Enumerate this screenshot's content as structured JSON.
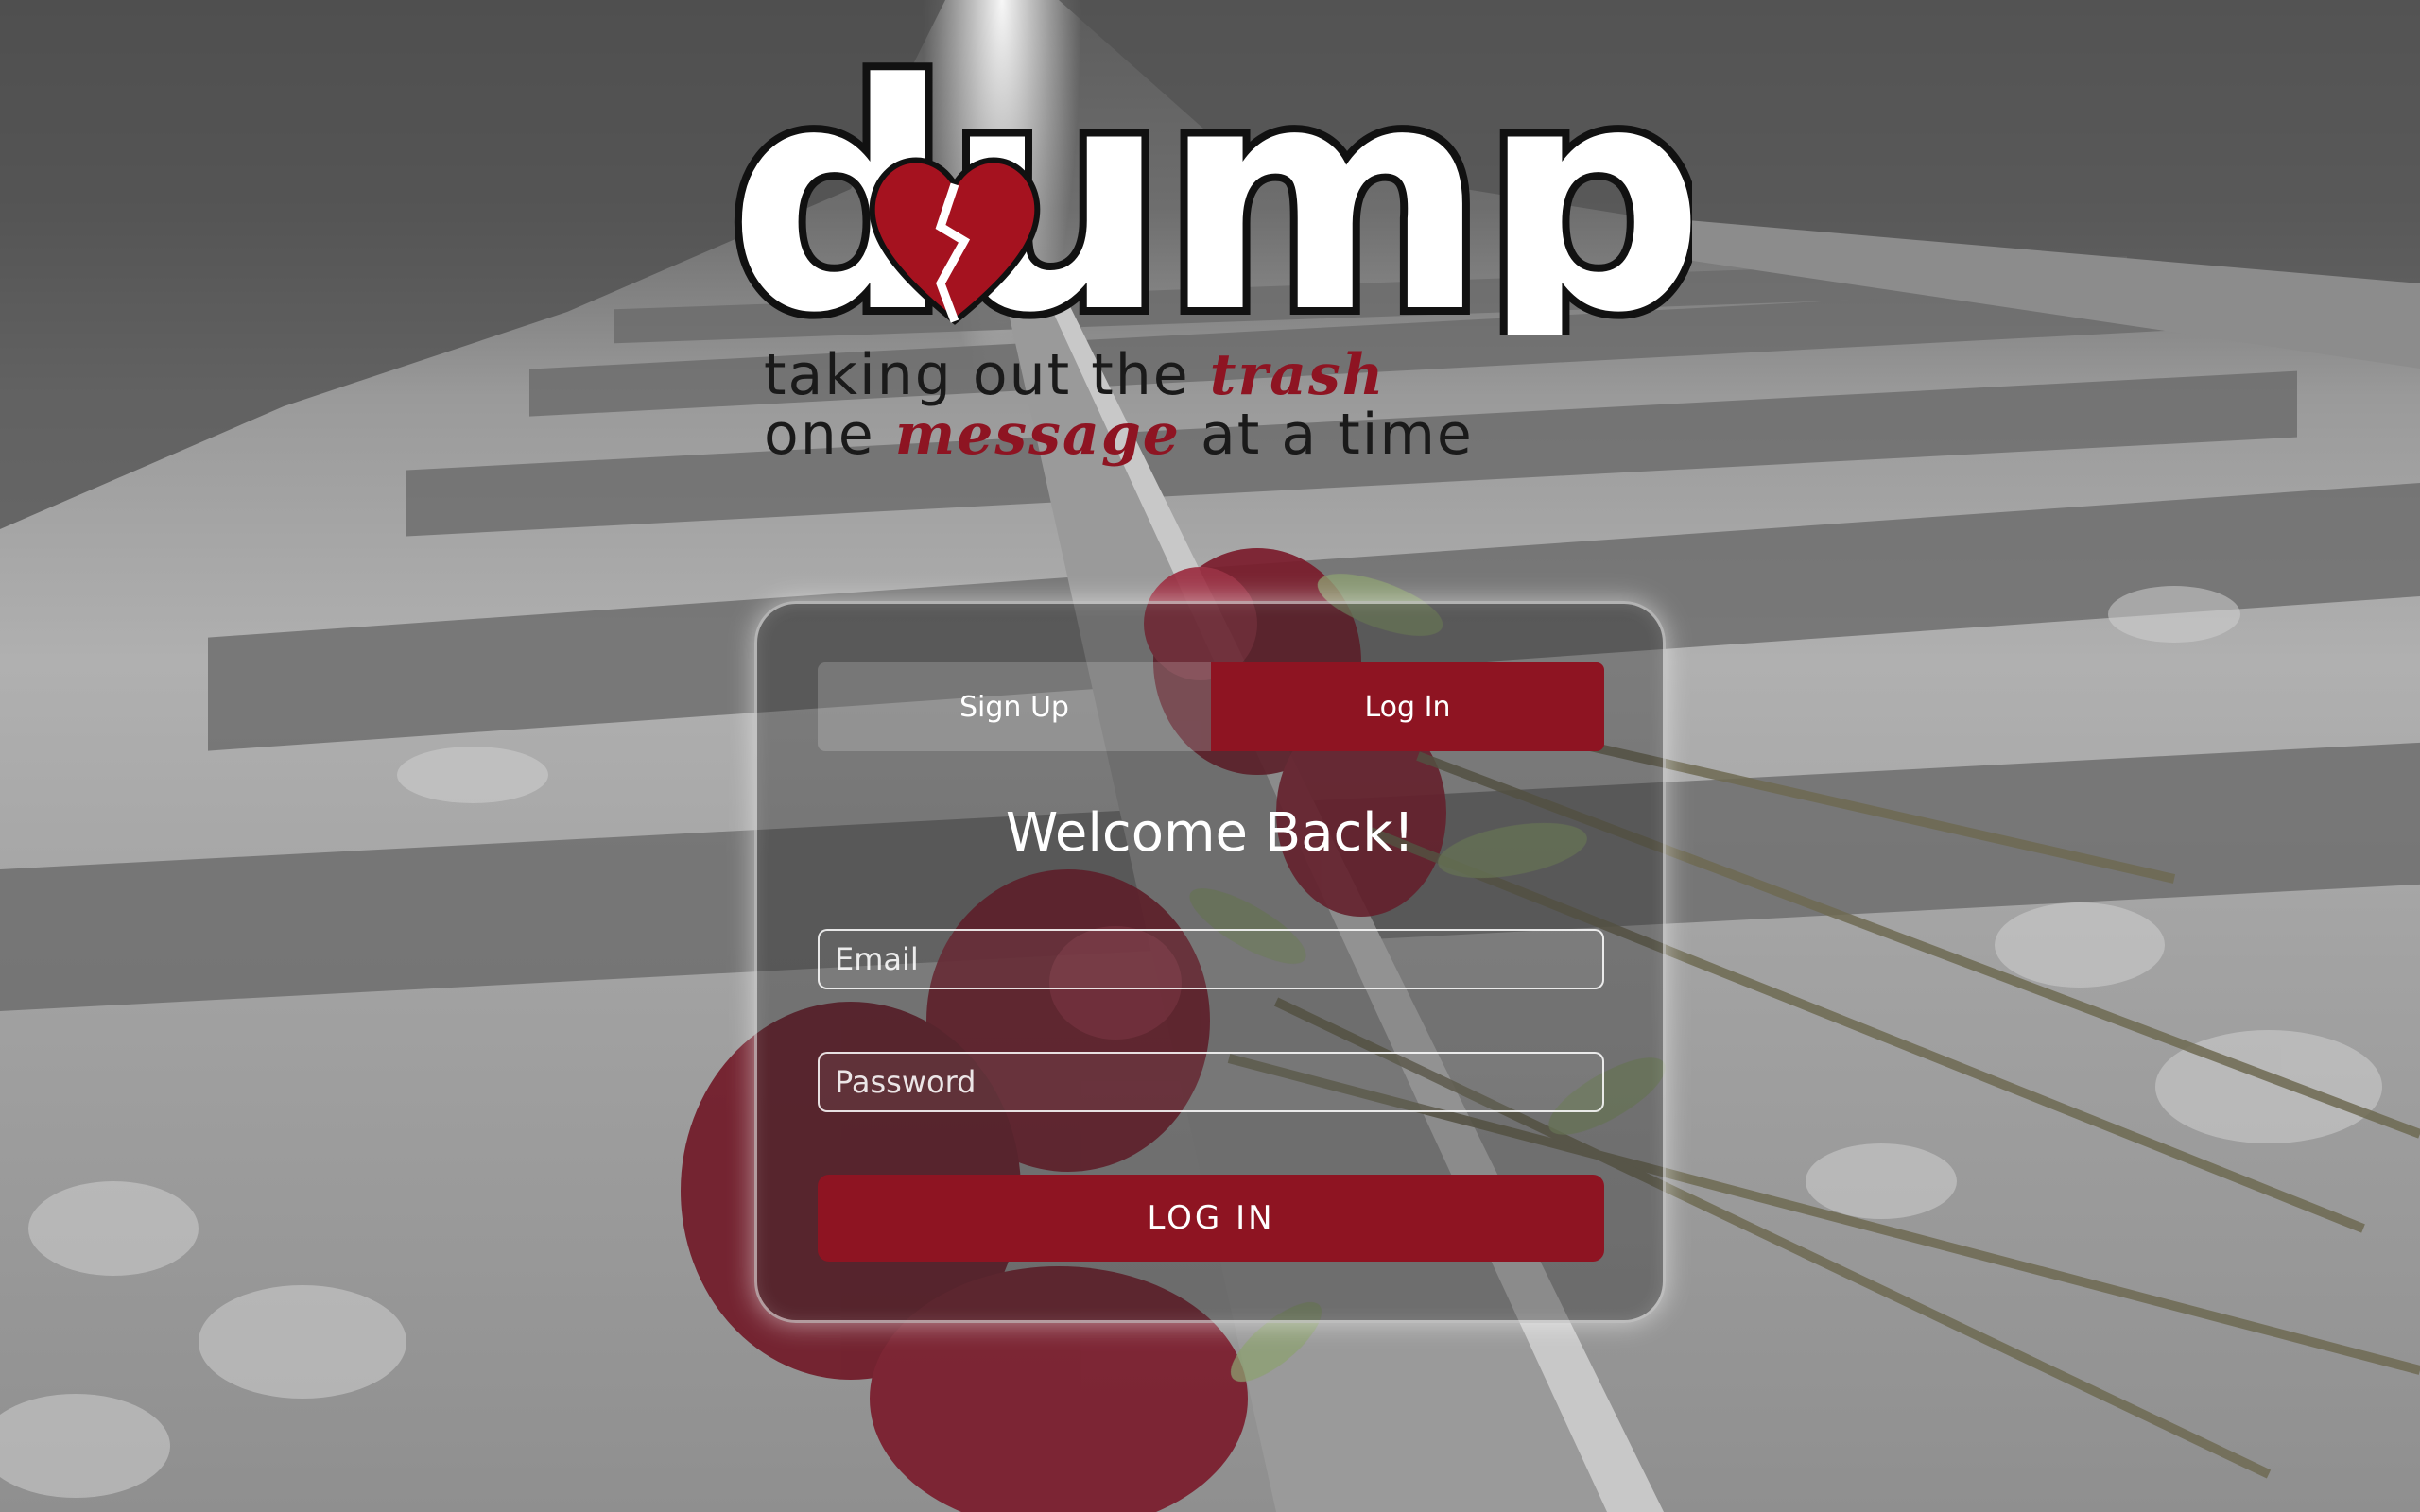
{
  "brand": {
    "logo_text": "dumpd",
    "tagline_line1_prefix": "taking out the ",
    "tagline_line1_accent": "trash",
    "tagline_line2_prefix": "one ",
    "tagline_line2_accent": "message",
    "tagline_line2_suffix": " at a time",
    "accent_color": "#8e1422"
  },
  "auth": {
    "tabs": [
      {
        "label": "Sign Up",
        "active": false
      },
      {
        "label": "Log In",
        "active": true
      }
    ],
    "heading": "Welcome Back!",
    "email_placeholder": "Email",
    "password_placeholder": "Password",
    "submit_label": "LOG IN"
  },
  "icons": {
    "logo_heart": "broken-heart-icon"
  }
}
